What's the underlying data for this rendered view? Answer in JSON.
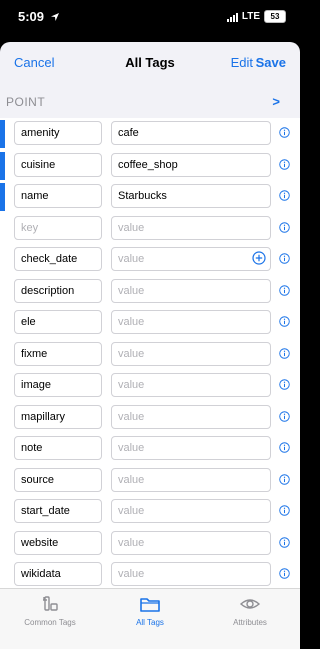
{
  "status_bar": {
    "time": "5:09",
    "network": "LTE",
    "battery": "53"
  },
  "nav": {
    "cancel": "Cancel",
    "title": "All Tags",
    "edit": "Edit",
    "save": "Save"
  },
  "point": {
    "label": "POINT",
    "chevron": ">"
  },
  "tags": [
    {
      "key": "amenity",
      "value": "cafe",
      "marked": true
    },
    {
      "key": "cuisine",
      "value": "coffee_shop",
      "marked": true
    },
    {
      "key": "name",
      "value": "Starbucks",
      "marked": true
    },
    {
      "key": "",
      "value": "",
      "key_placeholder": "key",
      "value_placeholder": "value"
    },
    {
      "key": "check_date",
      "value": "",
      "value_placeholder": "value",
      "add_button": true
    },
    {
      "key": "description",
      "value": "",
      "value_placeholder": "value"
    },
    {
      "key": "ele",
      "value": "",
      "value_placeholder": "value"
    },
    {
      "key": "fixme",
      "value": "",
      "value_placeholder": "value"
    },
    {
      "key": "image",
      "value": "",
      "value_placeholder": "value"
    },
    {
      "key": "mapillary",
      "value": "",
      "value_placeholder": "value"
    },
    {
      "key": "note",
      "value": "",
      "value_placeholder": "value"
    },
    {
      "key": "source",
      "value": "",
      "value_placeholder": "value"
    },
    {
      "key": "start_date",
      "value": "",
      "value_placeholder": "value"
    },
    {
      "key": "website",
      "value": "",
      "value_placeholder": "value"
    },
    {
      "key": "wikidata",
      "value": "",
      "value_placeholder": "value"
    }
  ],
  "tabbar": {
    "common": "Common Tags",
    "all": "All Tags",
    "attributes": "Attributes",
    "selected": "all"
  },
  "colors": {
    "accent": "#1a73e8",
    "background": "#f2f2f7",
    "placeholder": "#b0b0b5"
  },
  "icons": {
    "info": "info-circle-icon",
    "add": "plus-circle-icon",
    "common_tab": "common-tags-icon",
    "all_tab": "folder-icon",
    "attributes_tab": "eye-icon"
  }
}
